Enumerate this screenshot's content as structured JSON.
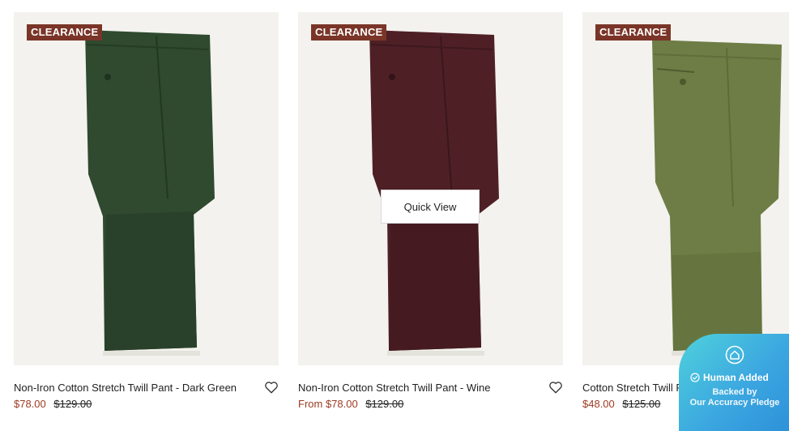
{
  "products": [
    {
      "badge": "CLEARANCE",
      "name": "Non-Iron Cotton Stretch Twill Pant - Dark Green",
      "sale_price": "$78.00",
      "original_price": "$129.00",
      "color": "#2f4a2f"
    },
    {
      "badge": "CLEARANCE",
      "name": "Non-Iron Cotton Stretch Twill Pant - Wine",
      "sale_price": "From $78.00",
      "original_price": "$129.00",
      "color": "#4e2026",
      "quick_view": "Quick View"
    },
    {
      "badge": "CLEARANCE",
      "name": "Cotton Stretch Twill Pants - Olive",
      "sale_price": "$48.00",
      "original_price": "$125.00",
      "color": "#6e7d45"
    }
  ],
  "pledge": {
    "title": "Human Added",
    "line1": "Backed by",
    "line2": "Our Accuracy Pledge"
  },
  "colors": {
    "badge": "#7a3528",
    "sale_price": "#9c3b22",
    "image_bg": "#f3f2ee",
    "pledge_gradient_start": "#4fd1dc",
    "pledge_gradient_end": "#2c8fd8"
  },
  "icons": {
    "wishlist": "heart-outline-icon",
    "pledge": "house-badge-icon",
    "check": "check-circle-icon"
  }
}
